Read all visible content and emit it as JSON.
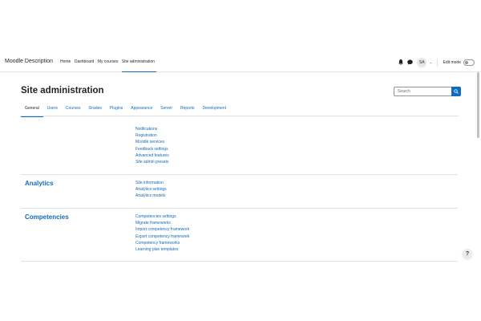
{
  "navbar": {
    "brand": "Moodle Description",
    "items": [
      {
        "label": "Home"
      },
      {
        "label": "Dashboard"
      },
      {
        "label": "My courses"
      },
      {
        "label": "Site administration"
      }
    ],
    "avatar_initials": "SA",
    "edit_mode_label": "Edit mode"
  },
  "header": {
    "title": "Site administration",
    "search_placeholder": "Search"
  },
  "tabs": [
    {
      "label": "General"
    },
    {
      "label": "Users"
    },
    {
      "label": "Courses"
    },
    {
      "label": "Grades"
    },
    {
      "label": "Plugins"
    },
    {
      "label": "Appearance"
    },
    {
      "label": "Server"
    },
    {
      "label": "Reports"
    },
    {
      "label": "Development"
    }
  ],
  "sections": [
    {
      "title": "",
      "links": [
        "Notifications",
        "Registration",
        "Moodle services",
        "Feedback settings",
        "Advanced features",
        "Site admin presets"
      ]
    },
    {
      "title": "Analytics",
      "links": [
        "Site information",
        "Analytics settings",
        "Analytics models"
      ]
    },
    {
      "title": "Competencies",
      "links": [
        "Competencies settings",
        "Migrate frameworks",
        "Import competency framework",
        "Export competency framework",
        "Competency frameworks",
        "Learning plan templates"
      ]
    }
  ],
  "help_label": "?",
  "colors": {
    "link": "#0f6cbf",
    "text": "#1d2125",
    "border": "#dee2e6"
  }
}
